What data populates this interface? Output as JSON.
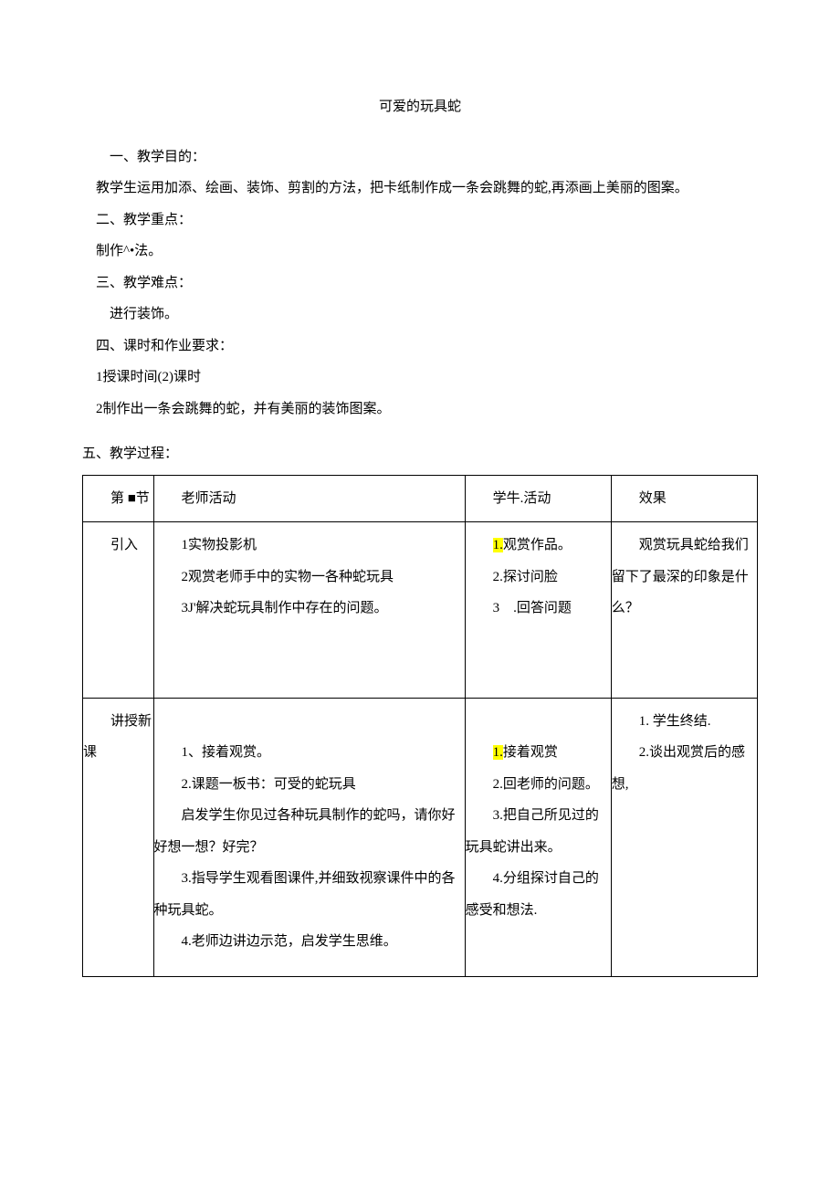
{
  "title": "可爱的玩具蛇",
  "sections": {
    "s1_heading": "一、教学目的：",
    "s1_content": "教学生运用加添、绘画、装饰、剪割的方法，把卡纸制作成一条会跳舞的蛇,再添画上美丽的图案。",
    "s2_heading": "二、教学重点：",
    "s2_content": "制作^•法。",
    "s3_heading": "三、教学难点：",
    "s3_content": "进行装饰。",
    "s4_heading": "四、课时和作业要求：",
    "s4_line1": "1授课时间(2)课时",
    "s4_line2": "2制作出一条会跳舞的蛇，并有美丽的装饰图案。",
    "s5_heading": "五、教学过程："
  },
  "table": {
    "header": {
      "c1": "第 ■节",
      "c2": "老师活动",
      "c3": "学牛.活动",
      "c4": "效果"
    },
    "row1": {
      "c1": "引入",
      "c2_l1": "1实物投影机",
      "c2_l2": "2观赏老师手中的实物一各种蛇玩具",
      "c2_l3": "3J'解决蛇玩具制作中存在的问题。",
      "c3_l1a": "1.",
      "c3_l1b": "观赏作品。",
      "c3_l2": "2.探讨问脸",
      "c3_l3": "3 .回答问题",
      "c4_l1": "观赏玩具蛇给我们留下了最深的印象是什么？"
    },
    "row2": {
      "c1": "讲授新课",
      "c2_l1": "1、接着观赏。",
      "c2_l2": "2.课题一板书：可受的蛇玩具",
      "c2_l3": "启发学生你见过各种玩具制作的蛇吗，请你好好想一想？好完？",
      "c2_l4": "3.指导学生观看图课件,并细致视察课件中的各种玩具蛇。",
      "c2_l5": "4.老师边讲边示范，启发学生思维。",
      "c3_l1a": "1.",
      "c3_l1b": "接着观赏",
      "c3_l2": "2.回老师的问题。",
      "c3_l3": "3.把自己所见过的玩具蛇讲出来。",
      "c3_l4": "4.分组探讨自己的感受和想法.",
      "c4_l1": "1. 学生终结.",
      "c4_l2": "2.谈出观赏后的感想,"
    }
  }
}
